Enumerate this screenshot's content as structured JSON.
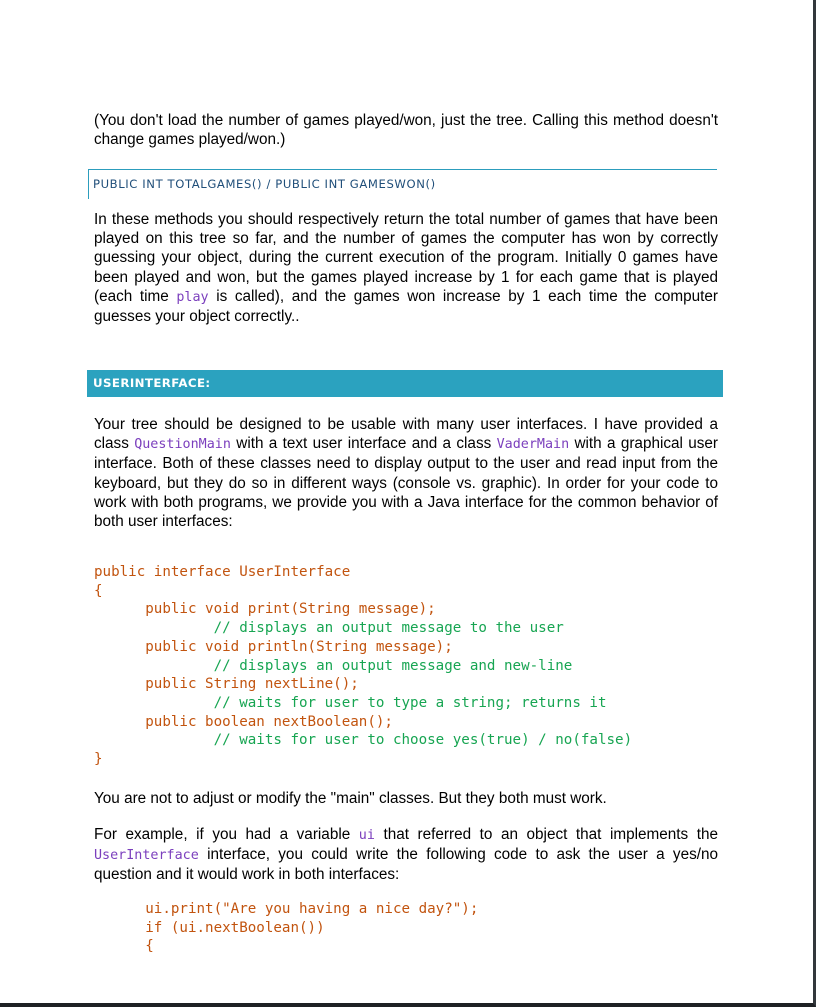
{
  "document": {
    "intro_paragraph": "(You don't load the number of games played/won, just the tree. Calling this method doesn't change games played/won.)",
    "method_heading": "PUBLIC INT TOTALGAMES()   /   PUBLIC INT GAMESWON()",
    "methods_paragraph": {
      "before_code": "In these methods you should respectively return the total number of games that have been played on this tree so far, and the number of games the computer has won by correctly guessing your object, during the current execution of the program. Initially 0 games have been played and won, but the games played increase by 1 for each game that is played (each time ",
      "inline_code": "play",
      "after_code": " is called), and the games won increase by 1 each time the computer guesses your object correctly.."
    },
    "section_banner": "USERINTERFACE:",
    "ui_paragraph": {
      "part1": "Your tree should be designed to be usable with many user interfaces. I have provided a class ",
      "code1": "QuestionMain",
      "part2": " with a text user interface and a class ",
      "code2": "VaderMain",
      "part3": " with a graphical user interface. Both of these classes need to display output to the user and read input from the keyboard, but they do so in different ways (console vs. graphic). In order for your code to work with both programs, we provide you with a Java interface for the common behavior of both user interfaces:"
    },
    "interface_code": [
      {
        "text": "public interface UserInterface",
        "type": "code"
      },
      {
        "text": "{",
        "type": "code"
      },
      {
        "text": "      public void print(String message);",
        "type": "code"
      },
      {
        "text": "              // displays an output message to the user",
        "type": "comment"
      },
      {
        "text": "      public void println(String message);",
        "type": "code"
      },
      {
        "text": "              // displays an output message and new-line",
        "type": "comment"
      },
      {
        "text": "      public String nextLine();",
        "type": "code"
      },
      {
        "text": "              // waits for user to type a string; returns it",
        "type": "comment"
      },
      {
        "text": "      public boolean nextBoolean();",
        "type": "code"
      },
      {
        "text": "              // waits for user to choose yes(true) / no(false)",
        "type": "comment"
      },
      {
        "text": "}",
        "type": "code"
      }
    ],
    "main_note": "You are not to adjust or modify the \"main\" classes.  But they both must work.",
    "example_paragraph": {
      "part1": "For example, if you had a variable ",
      "code1": "ui",
      "part2": " that referred to an object that implements the ",
      "code2": "UserInterface",
      "part3": " interface, you could write the following code to ask the user a yes/no question and it would work in both interfaces:"
    },
    "example_code": [
      "      ui.print(\"Are you having a nice day?\");",
      "      if (ui.nextBoolean())",
      "      {"
    ]
  },
  "colors": {
    "banner": "#2ba2bf",
    "heading_border": "#2c9dbd",
    "code": "#c2540f",
    "comment": "#17a552",
    "inline_code": "#7b3fbd"
  }
}
